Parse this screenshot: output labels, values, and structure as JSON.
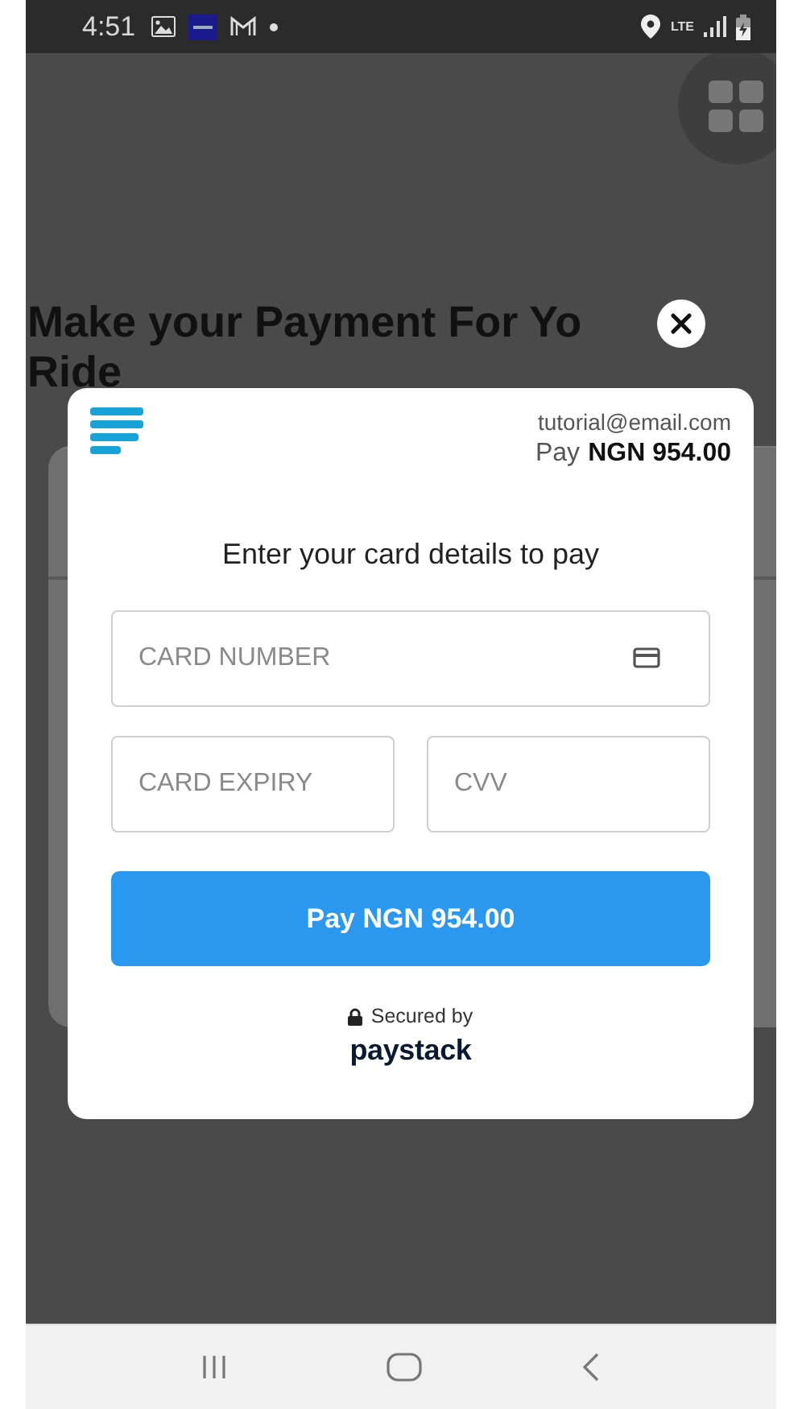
{
  "status_bar": {
    "time": "4:51",
    "network": "LTE"
  },
  "page": {
    "heading_lines": [
      "Make your Payment For Yo",
      "Ride"
    ]
  },
  "payment_modal": {
    "email": "tutorial@email.com",
    "amount_label": "Pay",
    "amount": "NGN 954.00",
    "title": "Enter your card details to pay",
    "fields": [
      {
        "kind": "card_number",
        "placeholder": "CARD NUMBER"
      },
      {
        "kind": "expiry",
        "placeholder": "CARD EXPIRY"
      },
      {
        "kind": "cvv",
        "placeholder": "CVV"
      }
    ],
    "pay_button": "Pay NGN 954.00",
    "secured_label": "Secured by",
    "brand": "paystack"
  }
}
